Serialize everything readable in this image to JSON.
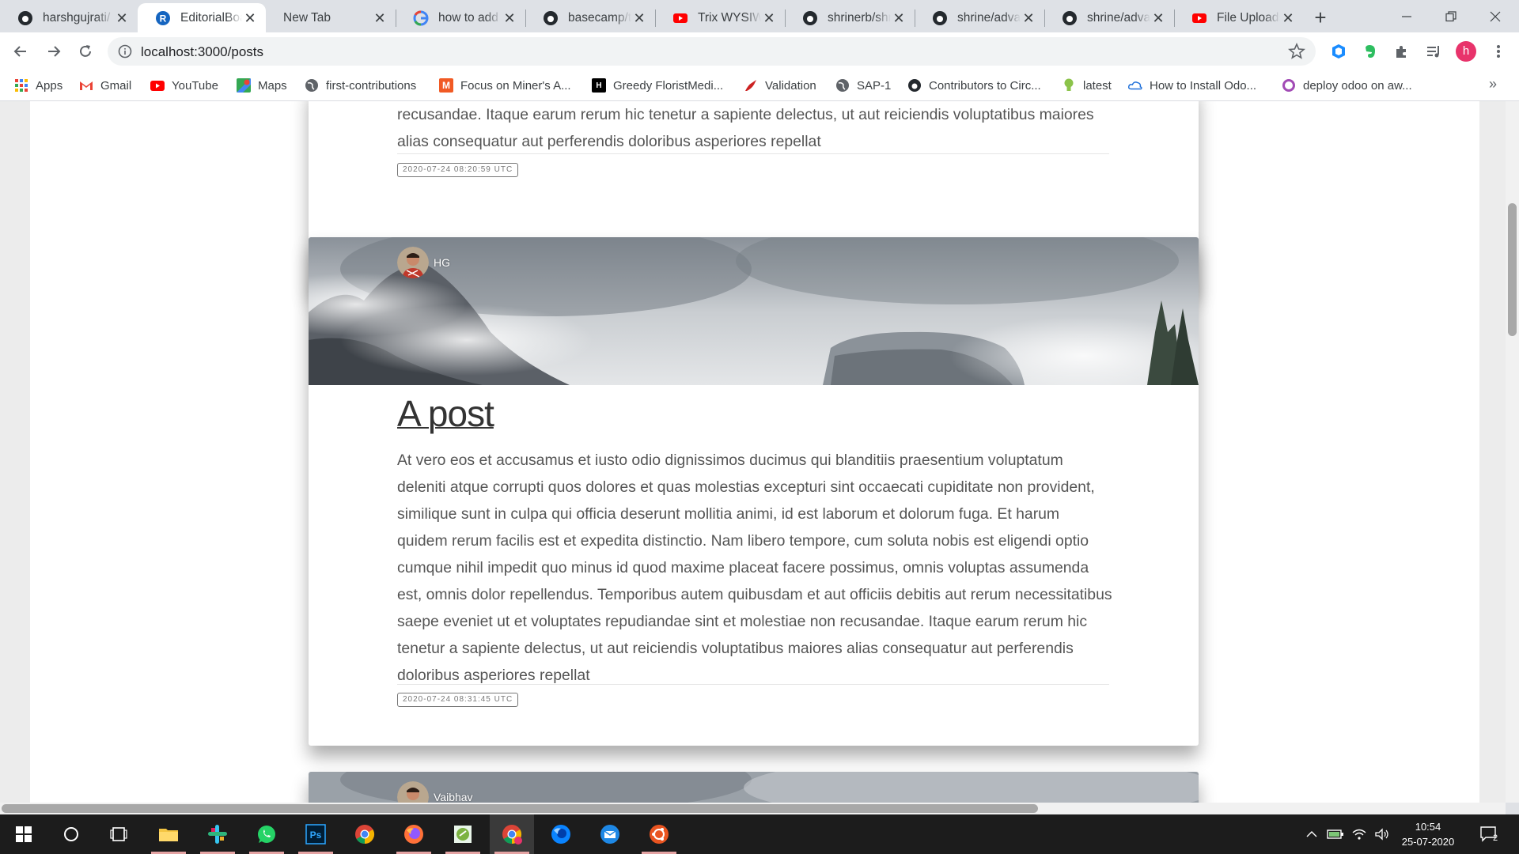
{
  "browser": {
    "tabs": [
      {
        "label": "harshgujrati/",
        "icon": "github-icon",
        "active": false
      },
      {
        "label": "EditorialBoard",
        "icon": "rails-icon",
        "active": true
      },
      {
        "label": "New Tab",
        "icon": "",
        "active": false
      },
      {
        "label": "how to add t",
        "icon": "google-icon",
        "active": false
      },
      {
        "label": "basecamp/tr",
        "icon": "github-icon",
        "active": false
      },
      {
        "label": "Trix WYSIWY",
        "icon": "youtube-icon",
        "active": false
      },
      {
        "label": "shrinerb/shr",
        "icon": "github-icon",
        "active": false
      },
      {
        "label": "shrine/advan",
        "icon": "github-icon",
        "active": false
      },
      {
        "label": "shrine/advan",
        "icon": "github-icon",
        "active": false
      },
      {
        "label": "File Uploads",
        "icon": "youtube-icon",
        "active": false
      }
    ],
    "url": "localhost:3000/posts",
    "profile_initial": "h",
    "bookmarks": [
      {
        "label": "Apps",
        "icon": "apps-grid-icon"
      },
      {
        "label": "Gmail",
        "icon": "gmail-icon"
      },
      {
        "label": "YouTube",
        "icon": "youtube-icon"
      },
      {
        "label": "Maps",
        "icon": "maps-icon"
      },
      {
        "label": "first-contributions",
        "icon": "globe-icon"
      },
      {
        "label": "Focus on Miner's A...",
        "icon": "medium-icon"
      },
      {
        "label": "Greedy FloristMedi...",
        "icon": "hackerrank-icon"
      },
      {
        "label": "Validation",
        "icon": "bird-icon"
      },
      {
        "label": "SAP-1",
        "icon": "globe-icon"
      },
      {
        "label": "Contributors to Circ...",
        "icon": "github-icon"
      },
      {
        "label": "latest",
        "icon": "bulb-icon"
      },
      {
        "label": "How to Install Odo...",
        "icon": "cloud-icon"
      },
      {
        "label": "deploy odoo on aw...",
        "icon": "ring-icon"
      }
    ]
  },
  "posts": [
    {
      "body_tail": "recusandae. Itaque earum rerum hic tenetur a sapiente delectus, ut aut reiciendis voluptatibus maiores alias consequatur aut perferendis doloribus asperiores repellat",
      "timestamp": "2020-07-24 08:20:59 UTC"
    },
    {
      "author": "HG",
      "title": "A post",
      "body": "At vero eos et accusamus et iusto odio dignissimos ducimus qui blanditiis praesentium voluptatum deleniti atque corrupti quos dolores et quas molestias excepturi sint occaecati cupiditate non provident, similique sunt in culpa qui officia deserunt mollitia animi, id est laborum et dolorum fuga. Et harum quidem rerum facilis est et expedita distinctio. Nam libero tempore, cum soluta nobis est eligendi optio cumque nihil impedit quo minus id quod maxime placeat facere possimus, omnis voluptas assumenda est, omnis dolor repellendus. Temporibus autem quibusdam et aut officiis debitis aut rerum necessitatibus saepe eveniet ut et voluptates repudiandae sint et molestiae non recusandae. Itaque earum rerum hic tenetur a sapiente delectus, ut aut reiciendis voluptatibus maiores alias consequatur aut perferendis doloribus asperiores repellat",
      "timestamp": "2020-07-24 08:31:45 UTC"
    },
    {
      "author": "Vaibhav"
    }
  ],
  "taskbar": {
    "apps": [
      "windows-start-icon",
      "search-circle-icon",
      "task-view-icon",
      "file-explorer-icon",
      "slack-icon",
      "whatsapp-icon",
      "photoshop-icon",
      "chrome-icon",
      "firefox-icon",
      "notepad-icon",
      "chrome-profile-icon",
      "firefox-dev-icon",
      "mail-icon",
      "ubuntu-icon"
    ],
    "time": "10:54",
    "date": "25-07-2020",
    "notification_count": "2"
  }
}
